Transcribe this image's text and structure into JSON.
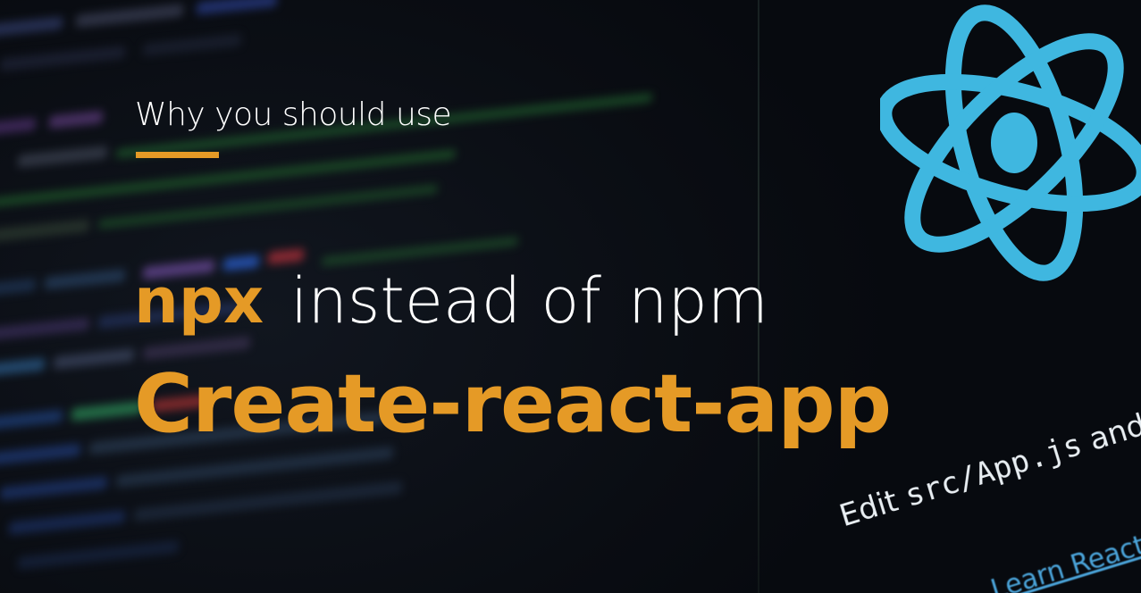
{
  "heading": {
    "kicker": "Why you should use",
    "npx": "npx",
    "middle": "instead of",
    "npm": "npm",
    "title": "Create-react-app"
  },
  "screen": {
    "edit_prefix": "Edit ",
    "edit_path": "src/App.js",
    "edit_suffix": " and save to",
    "learn_link": "Learn React"
  },
  "colors": {
    "accent": "#e59a26",
    "react_blue": "#3fb7e0",
    "background": "#0b0f16",
    "link": "#4aa3d8"
  },
  "icons": {
    "react_logo": "react-atom-icon"
  }
}
